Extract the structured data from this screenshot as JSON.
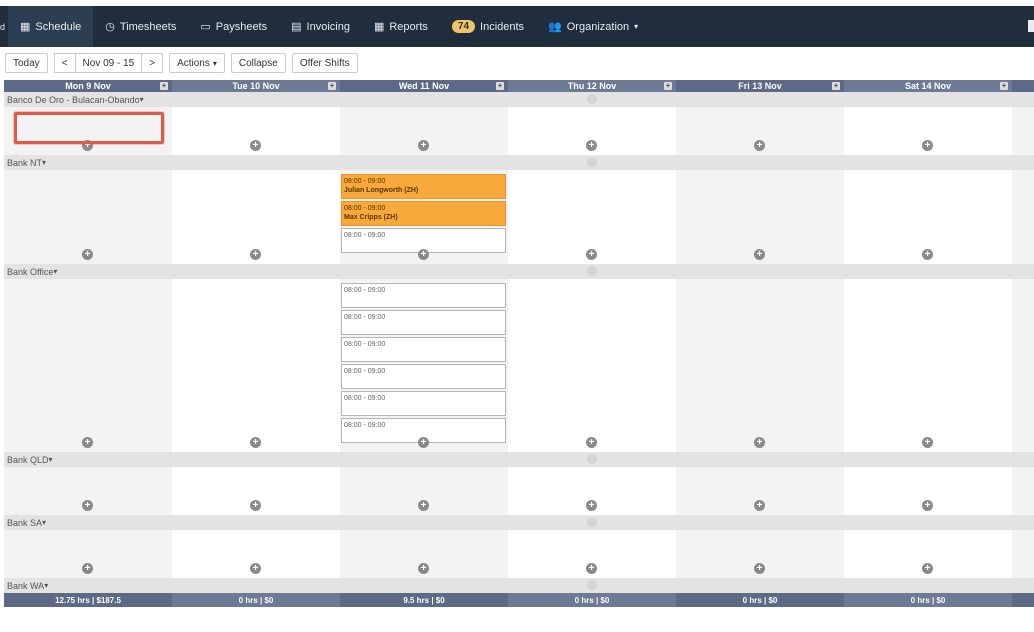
{
  "nav": {
    "items": [
      {
        "key": "schedule",
        "label": "Schedule",
        "icon": "calendar-icon",
        "active": true
      },
      {
        "key": "timesheets",
        "label": "Timesheets",
        "icon": "clock-icon"
      },
      {
        "key": "paysheets",
        "label": "Paysheets",
        "icon": "money-icon"
      },
      {
        "key": "invoicing",
        "label": "Invoicing",
        "icon": "invoice-icon"
      },
      {
        "key": "reports",
        "label": "Reports",
        "icon": "table-icon"
      },
      {
        "key": "incidents",
        "label": "Incidents",
        "icon": "badge",
        "badge": "74"
      },
      {
        "key": "organization",
        "label": "Organization",
        "icon": "users-icon",
        "dropdown": true
      }
    ]
  },
  "toolbar": {
    "today": "Today",
    "prev": "<",
    "range": "Nov 09 - 15",
    "next": ">",
    "actions": "Actions",
    "collapse": "Collapse",
    "offer": "Offer Shifts"
  },
  "days": [
    "Mon 9 Nov",
    "Tue 10 Nov",
    "Wed 11 Nov",
    "Thu 12 Nov",
    "Fri 13 Nov",
    "Sat 14 Nov"
  ],
  "groups": [
    {
      "name": "Banco De Oro - Bulacan-Obando",
      "shifts": []
    },
    {
      "name": "Bank NT",
      "shifts": [
        {
          "time": "08:00 - 09:00",
          "who": "Julian Longworth (ZH)",
          "filled": true
        },
        {
          "time": "08:00 - 09:00",
          "who": "Max Cripps (ZH)",
          "filled": true
        },
        {
          "time": "08:00 - 09:00",
          "who": "",
          "filled": false
        }
      ]
    },
    {
      "name": "Bank Office",
      "shifts": [
        {
          "time": "08:00 - 09:00",
          "who": "",
          "filled": false
        },
        {
          "time": "08:00 - 09:00",
          "who": "",
          "filled": false
        },
        {
          "time": "08:00 - 09:00",
          "who": "",
          "filled": false
        },
        {
          "time": "08:00 - 09:00",
          "who": "",
          "filled": false
        },
        {
          "time": "08:00 - 09:00",
          "who": "",
          "filled": false
        },
        {
          "time": "08:00 - 09:00",
          "who": "",
          "filled": false
        }
      ]
    },
    {
      "name": "Bank QLD",
      "shifts": []
    },
    {
      "name": "Bank SA",
      "shifts": []
    },
    {
      "name": "Bank WA",
      "shifts": []
    }
  ],
  "totals": [
    "12.75 hrs | $187.5",
    "0 hrs | $0",
    "9.5 hrs | $0",
    "0 hrs | $0",
    "0 hrs | $0",
    "0 hrs | $0"
  ]
}
